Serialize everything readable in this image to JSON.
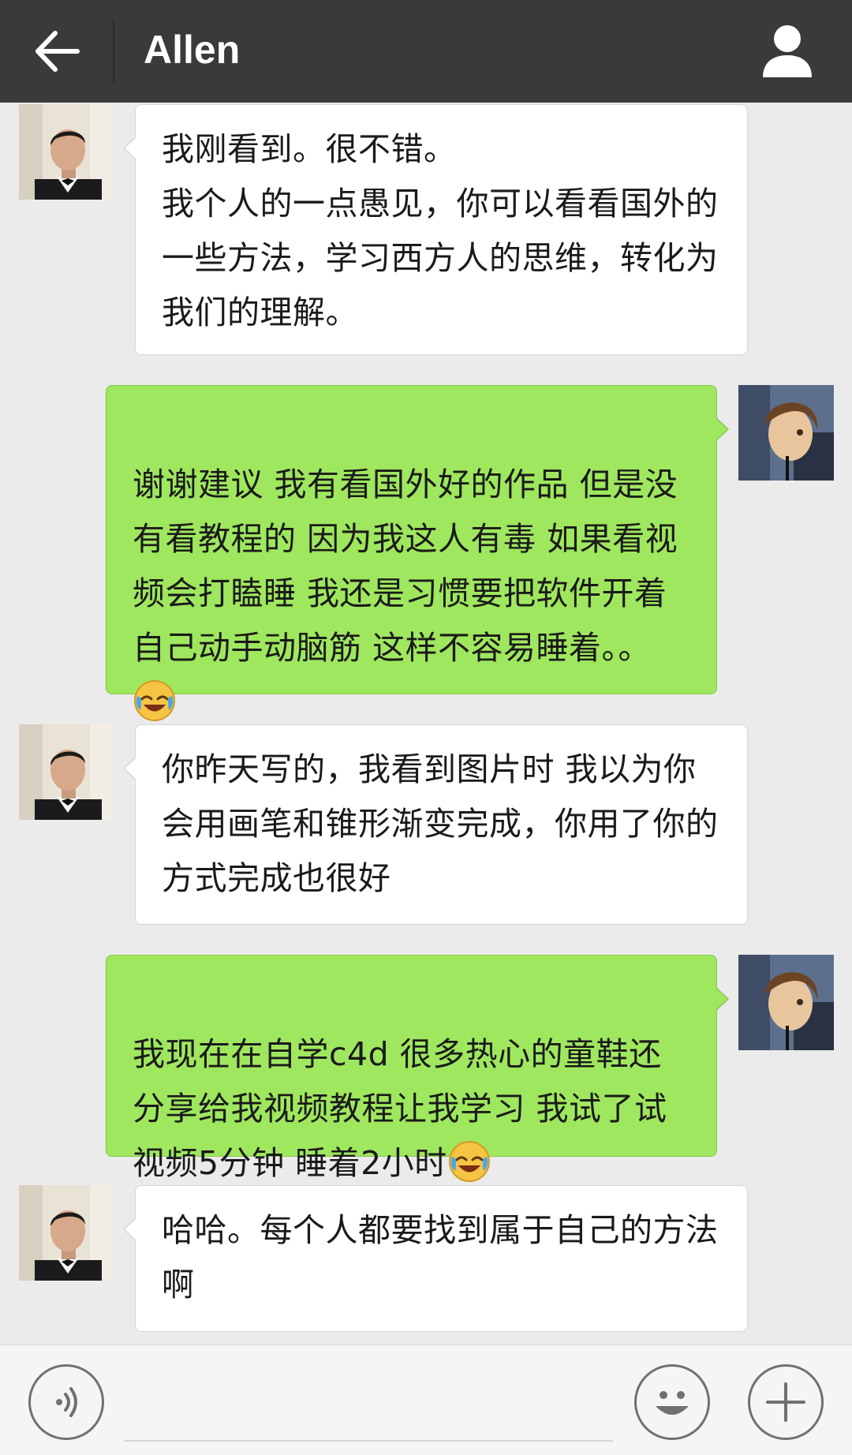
{
  "header": {
    "title": "Allen",
    "back_icon": "arrow-left-icon",
    "profile_icon": "person-icon"
  },
  "colors": {
    "header_bg": "#3a3a3c",
    "chat_bg": "#ebebeb",
    "incoming_bubble": "#ffffff",
    "outgoing_bubble": "#9fe75e"
  },
  "messages": [
    {
      "sender": "Allen",
      "direction": "incoming",
      "text": "我刚看到。很不错。\n我个人的一点愚见，你可以看看国外的一些方法，学习西方人的思维，转化为我们的理解。"
    },
    {
      "sender": "me",
      "direction": "outgoing",
      "text": "谢谢建议 我有看国外好的作品 但是没有看教程的 因为我这人有毒 如果看视频会打瞌睡 我还是习惯要把软件开着自己动手动脑筋 这样不容易睡着。。",
      "emoji": "laughing-crying-emoji"
    },
    {
      "sender": "Allen",
      "direction": "incoming",
      "text": "你昨天写的，我看到图片时 我以为你会用画笔和锥形渐变完成，你用了你的方式完成也很好"
    },
    {
      "sender": "me",
      "direction": "outgoing",
      "text": "我现在在自学c4d 很多热心的童鞋还分享给我视频教程让我学习 我试了试 视频5分钟 睡着2小时",
      "emoji": "laughing-crying-emoji"
    },
    {
      "sender": "Allen",
      "direction": "incoming",
      "text": "哈哈。每个人都要找到属于自己的方法啊"
    }
  ],
  "input_bar": {
    "voice_icon": "voice-icon",
    "emoji_icon": "smiley-icon",
    "plus_icon": "plus-icon",
    "text_value": ""
  }
}
